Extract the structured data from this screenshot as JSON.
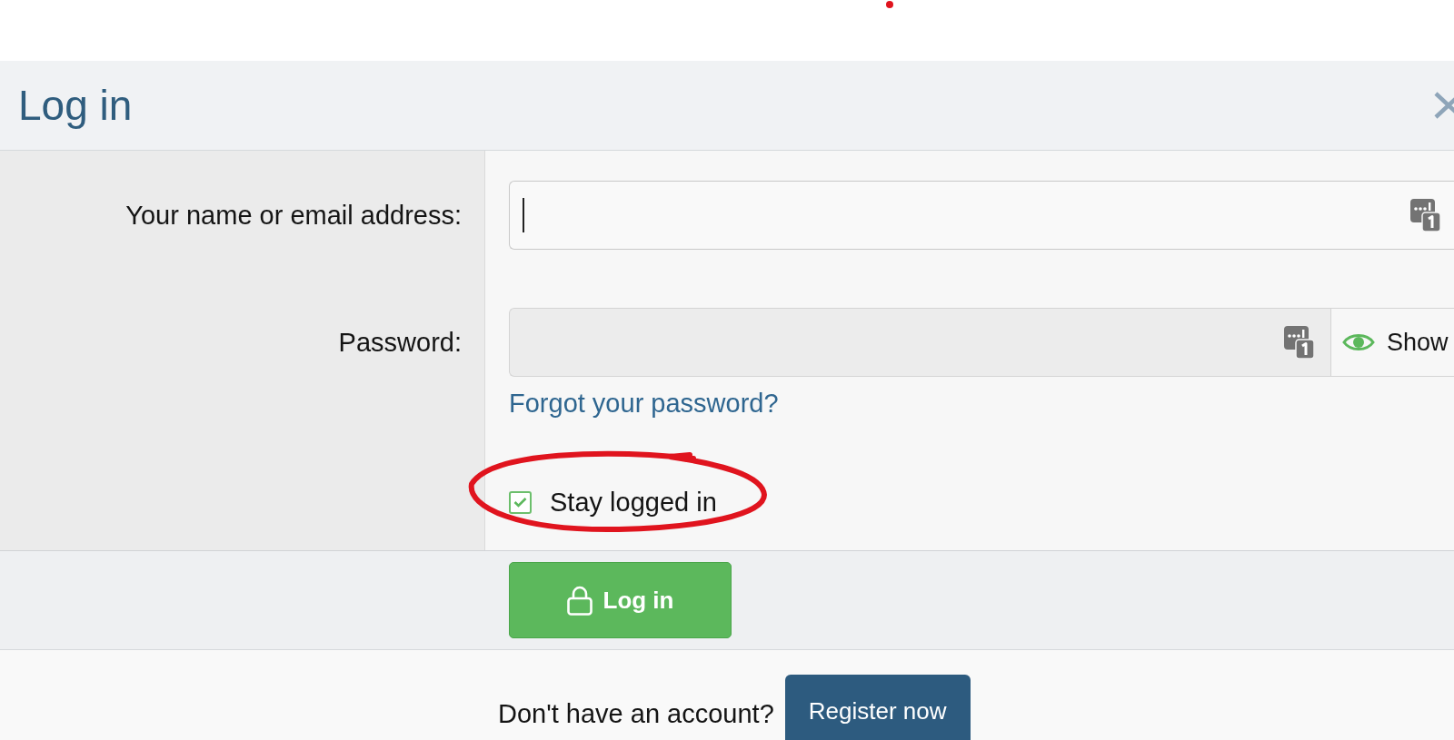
{
  "marker_dot": true,
  "dialog": {
    "title": "Log in"
  },
  "fields": [
    {
      "kind": "text",
      "label": "Your name or email address:",
      "focused": true
    },
    {
      "kind": "password",
      "label": "Password:",
      "focused": false,
      "toggle": "Show",
      "link": "Forgot your password?"
    }
  ],
  "stay_logged_in": {
    "label": "Stay logged in",
    "checked": true,
    "circled": true
  },
  "submit": {
    "label": "Log in"
  },
  "footer": {
    "prompt": "Don't have an account?",
    "button": "Register now"
  }
}
